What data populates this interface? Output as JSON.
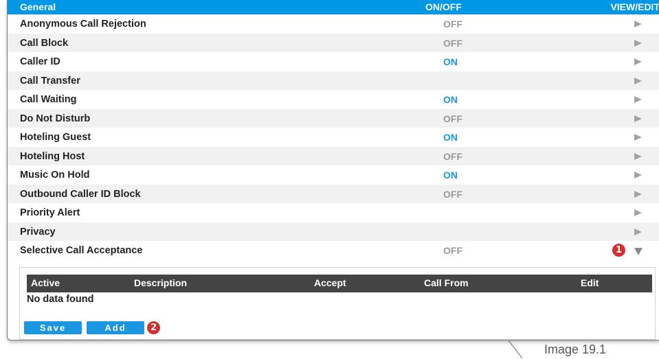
{
  "table": {
    "columns": {
      "general": "General",
      "on_off": "ON/OFF",
      "view_edit": "VIEW/EDIT"
    },
    "rows": [
      {
        "name": "Anonymous Call Rejection",
        "status": "OFF"
      },
      {
        "name": "Call Block",
        "status": "OFF"
      },
      {
        "name": "Caller ID",
        "status": "ON"
      },
      {
        "name": "Call Transfer",
        "status": ""
      },
      {
        "name": "Call Waiting",
        "status": "ON"
      },
      {
        "name": "Do Not Disturb",
        "status": "OFF"
      },
      {
        "name": "Hoteling Guest",
        "status": "ON"
      },
      {
        "name": "Hoteling Host",
        "status": "OFF"
      },
      {
        "name": "Music On Hold",
        "status": "ON"
      },
      {
        "name": "Outbound Caller ID Block",
        "status": "OFF"
      },
      {
        "name": "Priority Alert",
        "status": ""
      },
      {
        "name": "Privacy",
        "status": ""
      },
      {
        "name": "Selective Call Acceptance",
        "status": "OFF"
      }
    ]
  },
  "subpanel": {
    "columns": {
      "active": "Active",
      "description": "Description",
      "accept": "Accept",
      "call_from": "Call From",
      "edit": "Edit"
    },
    "empty_text": "No data found",
    "save_label": "Save",
    "add_label": "Add"
  },
  "badges": {
    "one": "1",
    "two": "2"
  },
  "caption": "Image 19.1",
  "colors": {
    "header": "#0097e6",
    "on": "#1b96e0",
    "off": "#999999",
    "badge": "#d32f2f",
    "subheader": "#444444"
  },
  "icons": {
    "row_arrow": "triangle-right-icon",
    "expanded_arrow": "triangle-down-icon"
  }
}
